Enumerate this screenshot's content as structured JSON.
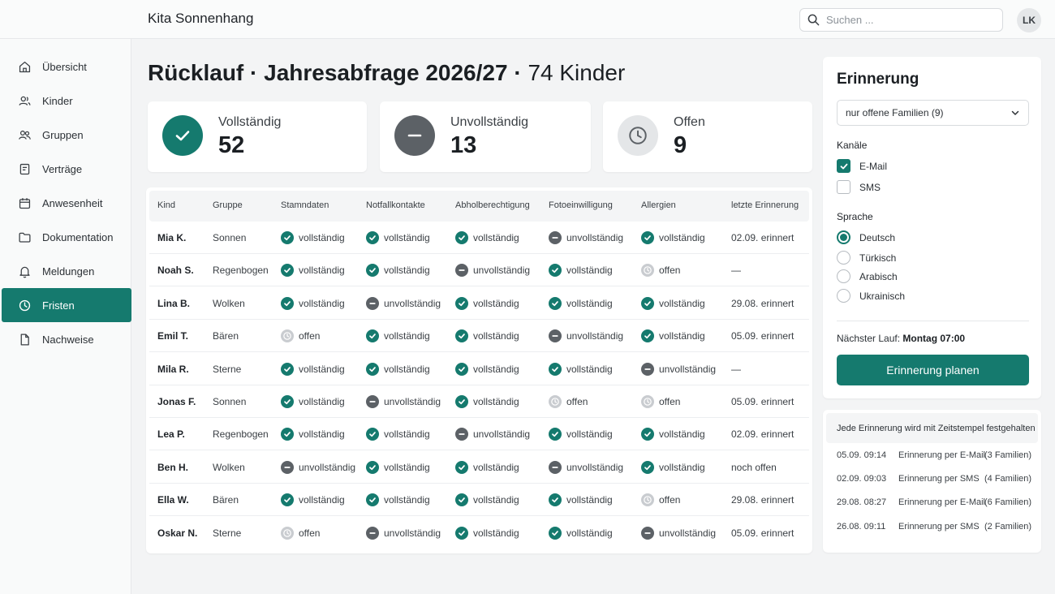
{
  "app": {
    "title": "Kita Sonnenhang"
  },
  "search": {
    "placeholder": "Suchen ..."
  },
  "user": {
    "initials": "LK"
  },
  "sidebar": {
    "items": [
      {
        "label": "Übersicht",
        "icon": "home-icon"
      },
      {
        "label": "Kinder",
        "icon": "users-icon"
      },
      {
        "label": "Gruppen",
        "icon": "group-icon"
      },
      {
        "label": "Verträge",
        "icon": "document-icon"
      },
      {
        "label": "Anwesenheit",
        "icon": "calendar-icon"
      },
      {
        "label": "Dokumentation",
        "icon": "folder-icon"
      },
      {
        "label": "Meldungen",
        "icon": "bell-icon"
      },
      {
        "label": "Fristen",
        "icon": "clock-icon",
        "active": true
      },
      {
        "label": "Nachweise",
        "icon": "file-icon"
      }
    ]
  },
  "page": {
    "title_bold": "Rücklauf · Jahresabfrage 2026/27 ·",
    "title_light": " 74 Kinder"
  },
  "stats": [
    {
      "label": "Vollständig",
      "value": "52",
      "icon": "check-icon"
    },
    {
      "label": "Unvollständig",
      "value": "13",
      "icon": "minus-icon"
    },
    {
      "label": "Offen",
      "value": "9",
      "icon": "clock-icon"
    }
  ],
  "table": {
    "headers": [
      "Kind",
      "Gruppe",
      "Stamndaten",
      "Notfallkontakte",
      "Abholberechtigung",
      "Fotoeinwilligung",
      "Allergien",
      "letzte Erinnerung"
    ],
    "rows": [
      {
        "kind": "Mia K.",
        "gruppe": "Sonnen",
        "cells": [
          "vollständig",
          "vollständig",
          "vollständig",
          "unvollständig",
          "vollständig"
        ],
        "erinnerung": "02.09. erinnert"
      },
      {
        "kind": "Noah S.",
        "gruppe": "Regenbogen",
        "cells": [
          "vollständig",
          "vollständig",
          "unvollständig",
          "vollständig",
          "offen"
        ],
        "erinnerung": "—"
      },
      {
        "kind": "Lina B.",
        "gruppe": "Wolken",
        "cells": [
          "vollständig",
          "unvollständig",
          "vollständig",
          "vollständig",
          "vollständig"
        ],
        "erinnerung": "29.08. erinnert"
      },
      {
        "kind": "Emil T.",
        "gruppe": "Bären",
        "cells": [
          "offen",
          "vollständig",
          "vollständig",
          "unvollständig",
          "vollständig"
        ],
        "erinnerung": "05.09. erinnert"
      },
      {
        "kind": "Mila R.",
        "gruppe": "Sterne",
        "cells": [
          "vollständig",
          "vollständig",
          "vollständig",
          "vollständig",
          "unvollständig"
        ],
        "erinnerung": "—"
      },
      {
        "kind": "Jonas F.",
        "gruppe": "Sonnen",
        "cells": [
          "vollständig",
          "unvollständig",
          "vollständig",
          "offen",
          "offen"
        ],
        "erinnerung": "05.09. erinnert"
      },
      {
        "kind": "Lea P.",
        "gruppe": "Regenbogen",
        "cells": [
          "vollständig",
          "vollständig",
          "unvollständig",
          "vollständig",
          "vollständig"
        ],
        "erinnerung": "02.09. erinnert"
      },
      {
        "kind": "Ben H.",
        "gruppe": "Wolken",
        "cells": [
          "unvollständig",
          "vollständig",
          "vollständig",
          "unvollständig",
          "vollständig"
        ],
        "erinnerung": "noch offen"
      },
      {
        "kind": "Ella W.",
        "gruppe": "Bären",
        "cells": [
          "vollständig",
          "vollständig",
          "vollständig",
          "vollständig",
          "offen"
        ],
        "erinnerung": "29.08. erinnert"
      },
      {
        "kind": "Oskar N.",
        "gruppe": "Sterne",
        "cells": [
          "offen",
          "unvollständig",
          "vollständig",
          "vollständig",
          "unvollständig"
        ],
        "erinnerung": "05.09. erinnert"
      }
    ]
  },
  "reminder": {
    "title": "Erinnerung",
    "target_selected": "nur offene Familien (9)",
    "channels_label": "Kanäle",
    "channels": [
      {
        "label": "E-Mail",
        "checked": true
      },
      {
        "label": "SMS",
        "checked": false
      }
    ],
    "language_label": "Sprache",
    "languages": [
      {
        "label": "Deutsch",
        "selected": true
      },
      {
        "label": "Türkisch",
        "selected": false
      },
      {
        "label": "Arabisch",
        "selected": false
      },
      {
        "label": "Ukrainisch",
        "selected": false
      }
    ],
    "next_run_label": "Nächster Lauf:",
    "next_run_value": "Montag 07:00",
    "cta_label": "Erinnerung planen"
  },
  "log": {
    "header": "Jede Erinnerung wird mit Zeitstempel festgehalten",
    "entries": [
      {
        "time": "05.09. 09:14",
        "text": "Erinnerung per E-Mail",
        "count": "(3 Familien)"
      },
      {
        "time": "02.09. 09:03",
        "text": "Erinnerung per SMS",
        "count": "(4 Familien)"
      },
      {
        "time": "29.08. 08:27",
        "text": "Erinnerung per E-Mail",
        "count": "(6 Familien)"
      },
      {
        "time": "26.08. 09:11",
        "text": "Erinnerung per SMS",
        "count": "(2 Familien)"
      }
    ]
  },
  "colors": {
    "accent": "#157a6e",
    "partial": "#5c6166",
    "open": "#c9ccd0"
  }
}
